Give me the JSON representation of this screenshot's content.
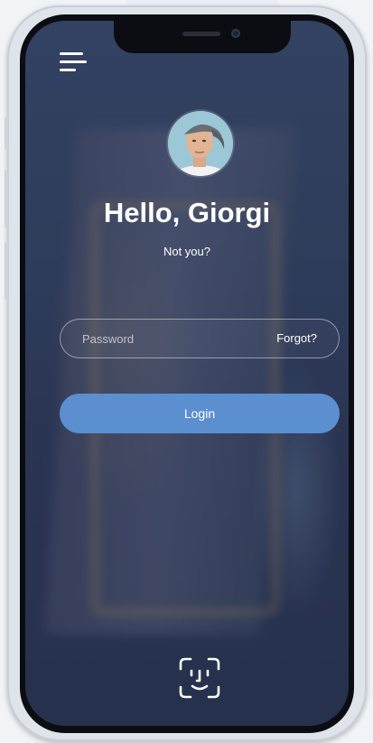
{
  "header": {
    "menu_icon": "hamburger-menu-icon"
  },
  "profile": {
    "avatar_icon": "user-avatar",
    "greeting": "Hello, Giorgi",
    "not_you_label": "Not you?"
  },
  "login_form": {
    "password_placeholder": "Password",
    "password_value": "",
    "forgot_label": "Forgot?",
    "login_label": "Login"
  },
  "biometric": {
    "icon": "face-id-icon"
  },
  "colors": {
    "accent": "#5b8fd0",
    "overlay": "#34425f",
    "text": "#ffffff"
  }
}
